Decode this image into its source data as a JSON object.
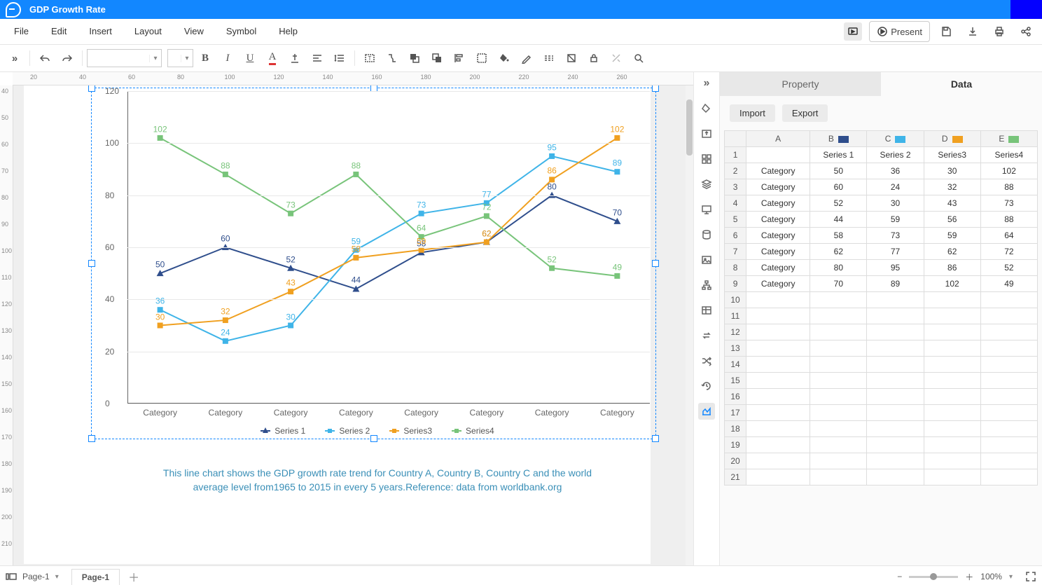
{
  "titlebar": {
    "doc_title": "GDP Growth Rate"
  },
  "menubar": {
    "items": [
      "File",
      "Edit",
      "Insert",
      "Layout",
      "View",
      "Symbol",
      "Help"
    ],
    "present_label": "Present"
  },
  "statusbar": {
    "page_selector": "Page-1",
    "page_tab": "Page-1",
    "zoom_label": "100%"
  },
  "right_panel": {
    "tabs": {
      "property": "Property",
      "data": "Data"
    },
    "actions": {
      "import": "Import",
      "export": "Export"
    },
    "columns": [
      "",
      "A",
      "B",
      "C",
      "D",
      "E"
    ],
    "header_row": [
      "",
      "Series 1",
      "Series 2",
      "Series3",
      "Series4"
    ],
    "rows": [
      [
        "Category",
        "50",
        "36",
        "30",
        "102"
      ],
      [
        "Category",
        "60",
        "24",
        "32",
        "88"
      ],
      [
        "Category",
        "52",
        "30",
        "43",
        "73"
      ],
      [
        "Category",
        "44",
        "59",
        "56",
        "88"
      ],
      [
        "Category",
        "58",
        "73",
        "59",
        "64"
      ],
      [
        "Category",
        "62",
        "77",
        "62",
        "72"
      ],
      [
        "Category",
        "80",
        "95",
        "86",
        "52"
      ],
      [
        "Category",
        "70",
        "89",
        "102",
        "49"
      ]
    ],
    "empty_rows": 13
  },
  "chart_data": {
    "type": "line",
    "categories": [
      "Category",
      "Category",
      "Category",
      "Category",
      "Category",
      "Category",
      "Category",
      "Category"
    ],
    "series": [
      {
        "name": "Series 1",
        "color": "#2f4e8c",
        "marker": "triangle",
        "values": [
          50,
          60,
          52,
          44,
          58,
          62,
          80,
          70
        ]
      },
      {
        "name": "Series 2",
        "color": "#3fb4e8",
        "marker": "square",
        "values": [
          36,
          24,
          30,
          59,
          73,
          77,
          95,
          89
        ]
      },
      {
        "name": "Series3",
        "color": "#f0a020",
        "marker": "square",
        "values": [
          30,
          32,
          43,
          56,
          59,
          62,
          86,
          102
        ]
      },
      {
        "name": "Series4",
        "color": "#78c47a",
        "marker": "square",
        "values": [
          102,
          88,
          73,
          88,
          64,
          72,
          52,
          49
        ]
      }
    ],
    "special_labels": {
      "series3_idx3_display": "58"
    },
    "ylim": [
      0,
      120
    ],
    "ytick": 20,
    "legend_position": "bottom",
    "caption": "This line chart shows the GDP growth rate trend for Country A, Country B, Country C and the world average level from1965 to 2015 in every 5 years.Reference: data from worldbank.org"
  },
  "colors": {
    "s1": "#2f4e8c",
    "s2": "#3fb4e8",
    "s3": "#f0a020",
    "s4": "#78c47a",
    "accent": "#1287ff"
  },
  "hruler_ticks": [
    20,
    40,
    60,
    80,
    100,
    120,
    140,
    160,
    180,
    200,
    220,
    240,
    260
  ],
  "vruler_ticks": [
    40,
    50,
    60,
    70,
    80,
    90,
    100,
    110,
    120,
    130,
    140,
    150,
    160,
    170,
    180,
    190,
    200,
    210
  ]
}
